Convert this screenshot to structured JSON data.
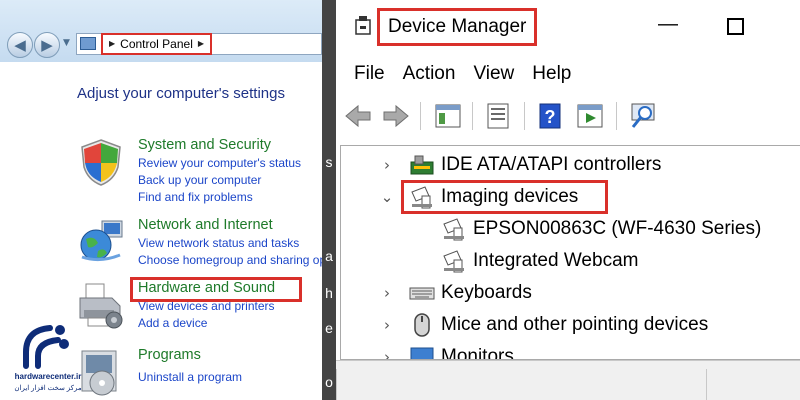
{
  "control_panel": {
    "address": {
      "crumb": "Control Panel"
    },
    "heading": "Adjust your computer's settings",
    "categories": [
      {
        "title": "System and Security",
        "icon": "shield-icon",
        "links": [
          "Review your computer's status",
          "Back up your computer",
          "Find and fix problems"
        ]
      },
      {
        "title": "Network and Internet",
        "icon": "globe-network-icon",
        "links": [
          "View network status and tasks",
          "Choose homegroup and sharing options"
        ]
      },
      {
        "title": "Hardware and Sound",
        "icon": "printer-icon",
        "links": [
          "View devices and printers",
          "Add a device"
        ]
      },
      {
        "title": "Programs",
        "icon": "programs-icon",
        "links": [
          "Uninstall a program"
        ]
      }
    ],
    "watermark": {
      "name": "hardwarecenter.ir",
      "subtitle": "مرکز سخت افزار ایران"
    }
  },
  "middle_strip": {
    "chars": [
      "s",
      "a",
      "h",
      "e",
      "o"
    ]
  },
  "device_manager": {
    "title": "Device Manager",
    "window_controls": {
      "minimize": "—"
    },
    "menu": [
      "File",
      "Action",
      "View",
      "Help"
    ],
    "toolbar": [
      "back-arrow-icon",
      "forward-arrow-icon",
      "show-hide-console-tree-icon",
      "properties-icon",
      "help-icon",
      "run-icon",
      "scan-hardware-icon"
    ],
    "tree": [
      {
        "label": "IDE ATA/ATAPI controllers",
        "expander": "›",
        "icon": "ide-controller-icon",
        "level": 0
      },
      {
        "label": "Imaging devices",
        "expander": "⌄",
        "icon": "camera-icon",
        "level": 0
      },
      {
        "label": "EPSON00863C (WF-4630 Series)",
        "expander": "",
        "icon": "camera-icon",
        "level": 1
      },
      {
        "label": "Integrated Webcam",
        "expander": "",
        "icon": "camera-icon",
        "level": 1
      },
      {
        "label": "Keyboards",
        "expander": "›",
        "icon": "keyboard-icon",
        "level": 0
      },
      {
        "label": "Mice and other pointing devices",
        "expander": "›",
        "icon": "mouse-icon",
        "level": 0
      },
      {
        "label": "Monitors",
        "expander": "›",
        "icon": "monitor-icon",
        "level": 0
      }
    ]
  },
  "colors": {
    "highlight_border": "#d9302a",
    "category_title": "#1e7a2a",
    "link": "#1c46c9",
    "heading": "#1e3287"
  }
}
